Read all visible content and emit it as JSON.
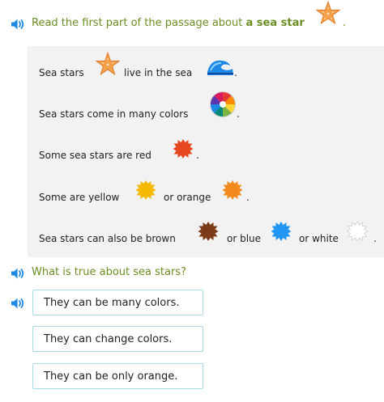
{
  "question": {
    "prompt_prefix": "Read the first part of the passage about ",
    "prompt_bold": "a sea star",
    "prompt_suffix": "."
  },
  "passage": {
    "line1": {
      "a": "Sea stars",
      "b": "live in the sea",
      "c": "."
    },
    "line2": {
      "a": "Sea stars come in many colors",
      "b": "."
    },
    "line3": {
      "a": "Some sea stars are red",
      "b": "."
    },
    "line4": {
      "a": "Some are yellow",
      "b": "or orange",
      "c": "."
    },
    "line5": {
      "a": "Sea stars can also be brown",
      "b": "or blue",
      "c": "or white",
      "d": "."
    }
  },
  "subquestion": "What is true about sea stars?",
  "choices": [
    {
      "label": "They can be many colors."
    },
    {
      "label": "They can change colors."
    },
    {
      "label": "They can be only orange."
    }
  ],
  "colors": {
    "prompt_green": "#6b8e23",
    "speaker_blue": "#1e88e5",
    "starfish_orange": "#f5a04a",
    "red": "#e8461e",
    "yellow": "#f4b800",
    "orange": "#f28a1e",
    "brown": "#7a3b16",
    "blue": "#2196f3",
    "white": "#ffffff",
    "border": "#a8dbe6",
    "passage_bg": "#f2f2f2"
  },
  "icons": [
    "speaker-icon",
    "sea-star-icon",
    "sea-wave-icon",
    "color-wheel-icon",
    "color-splat-icon"
  ]
}
